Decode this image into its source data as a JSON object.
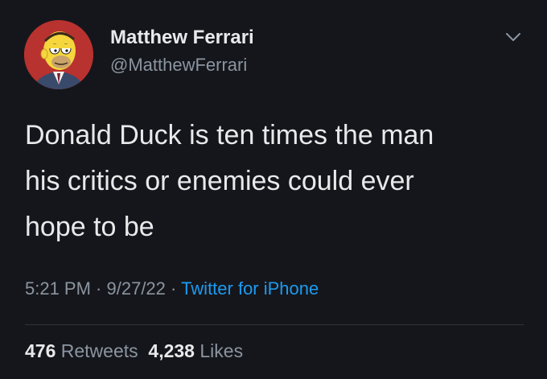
{
  "user": {
    "display_name": "Matthew Ferrari",
    "handle": "@MatthewFerrari",
    "avatar_icon": "cartoon-avatar"
  },
  "tweet": {
    "lines": [
      "Donald Duck is ten times the man",
      "his critics or enemies could ever",
      "hope to be"
    ]
  },
  "meta": {
    "time": "5:21 PM",
    "separator1": " · ",
    "date": "9/27/22",
    "separator2": " · ",
    "source": "Twitter for iPhone"
  },
  "stats": {
    "retweets_count": "476",
    "retweets_label": "Retweets",
    "likes_count": "4,238",
    "likes_label": "Likes"
  },
  "colors": {
    "background": "#15161b",
    "text": "#e8e9ea",
    "secondary": "#8b95a0",
    "link": "#1d9bf0"
  },
  "icons": {
    "menu": "chevron-down-icon"
  }
}
